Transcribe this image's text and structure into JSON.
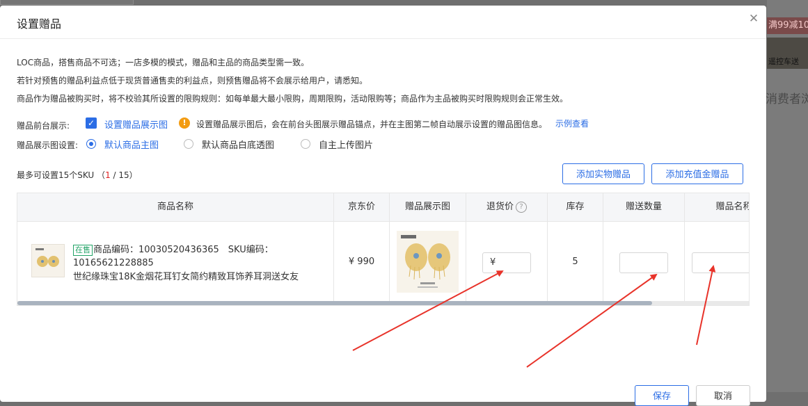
{
  "background": {
    "promo": "满99减10",
    "cart": "遥控车送",
    "consumer": "消费者浏"
  },
  "modal": {
    "title": "设置赠品",
    "notes": [
      "LOC商品，搭售商品不可选；一店多模的模式，赠品和主品的商品类型需一致。",
      "若针对预售的赠品利益点低于现货普通售卖的利益点，则预售赠品将不会展示给用户，请悉知。",
      "商品作为赠品被购买时，将不校验其所设置的限购规则：如每单最大最小限购，周期限购，活动限购等；商品作为主品被购买时限购规则会正常生效。"
    ],
    "front_display": {
      "label": "赠品前台展示:",
      "checkbox_label": "设置赠品展示图",
      "hint": "设置赠品展示图后，会在前台头图展示赠品锚点，并在主图第二帧自动展示设置的赠品图信息。",
      "example_link": "示例查看"
    },
    "image_setting": {
      "label": "赠品展示图设置:",
      "options": [
        "默认商品主图",
        "默认商品白底透图",
        "自主上传图片"
      ],
      "selected": 0
    },
    "sku_limit": {
      "prefix": "最多可设置15个SKU",
      "current": "1",
      "total": "/ 15"
    },
    "buttons": {
      "add_physical": "添加实物赠品",
      "add_recharge": "添加充值金赠品",
      "save": "保存",
      "cancel": "取消"
    },
    "table": {
      "headers": [
        "商品名称",
        "京东价",
        "赠品展示图",
        "退货价",
        "库存",
        "赠送数量",
        "赠品名称"
      ],
      "row": {
        "status": "在售",
        "code_line": "商品编码：10030520436365　SKU编码：10165621228885",
        "name": "世纪缘珠宝18K金烟花耳钉女简约精致耳饰养耳洞送女友",
        "price": "¥ 990",
        "return_price_prefix": "¥",
        "stock": "5",
        "gift_qty": "",
        "gift_name": ""
      }
    }
  },
  "colors": {
    "accent": "#2b6de5",
    "annotation_arrow": "#e8332a",
    "status_green": "#21a366"
  }
}
